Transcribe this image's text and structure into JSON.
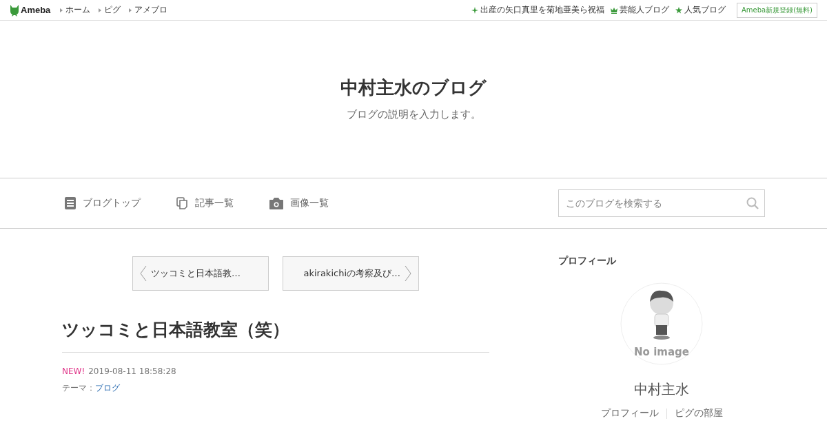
{
  "topbar": {
    "logo": "Ameba",
    "links": [
      "ホーム",
      "ピグ",
      "アメブロ"
    ],
    "right_links": [
      {
        "kind": "sparkle",
        "label": "出産の矢口真里を菊地亜美ら祝福"
      },
      {
        "kind": "crown",
        "label": "芸能人ブログ"
      },
      {
        "kind": "star",
        "label": "人気ブログ"
      }
    ],
    "signup": "Ameba新規登録(無料)"
  },
  "header": {
    "title": "中村主水のブログ",
    "description": "ブログの説明を入力します。"
  },
  "nav": {
    "items": [
      {
        "kind": "doc",
        "label": "ブログトップ"
      },
      {
        "kind": "copy",
        "label": "記事一覧"
      },
      {
        "kind": "camera",
        "label": "画像一覧"
      }
    ],
    "search": {
      "placeholder": "このブログを検索する"
    }
  },
  "pager": [
    {
      "kind": "prev",
      "label": "ツッコミと日本語教…"
    },
    {
      "kind": "next",
      "label": "akirakichiの考察及び…"
    }
  ],
  "article": {
    "title": "ツッコミと日本語教室（笑）",
    "badge": "NEW!",
    "date": "2019-08-11 18:58:28",
    "theme_label": "テーマ：",
    "theme": "ブログ"
  },
  "sidebar": {
    "heading": "プロフィール",
    "avatar_caption": "No image",
    "name": "中村主水",
    "links": [
      "プロフィール",
      "ピグの部屋"
    ]
  }
}
